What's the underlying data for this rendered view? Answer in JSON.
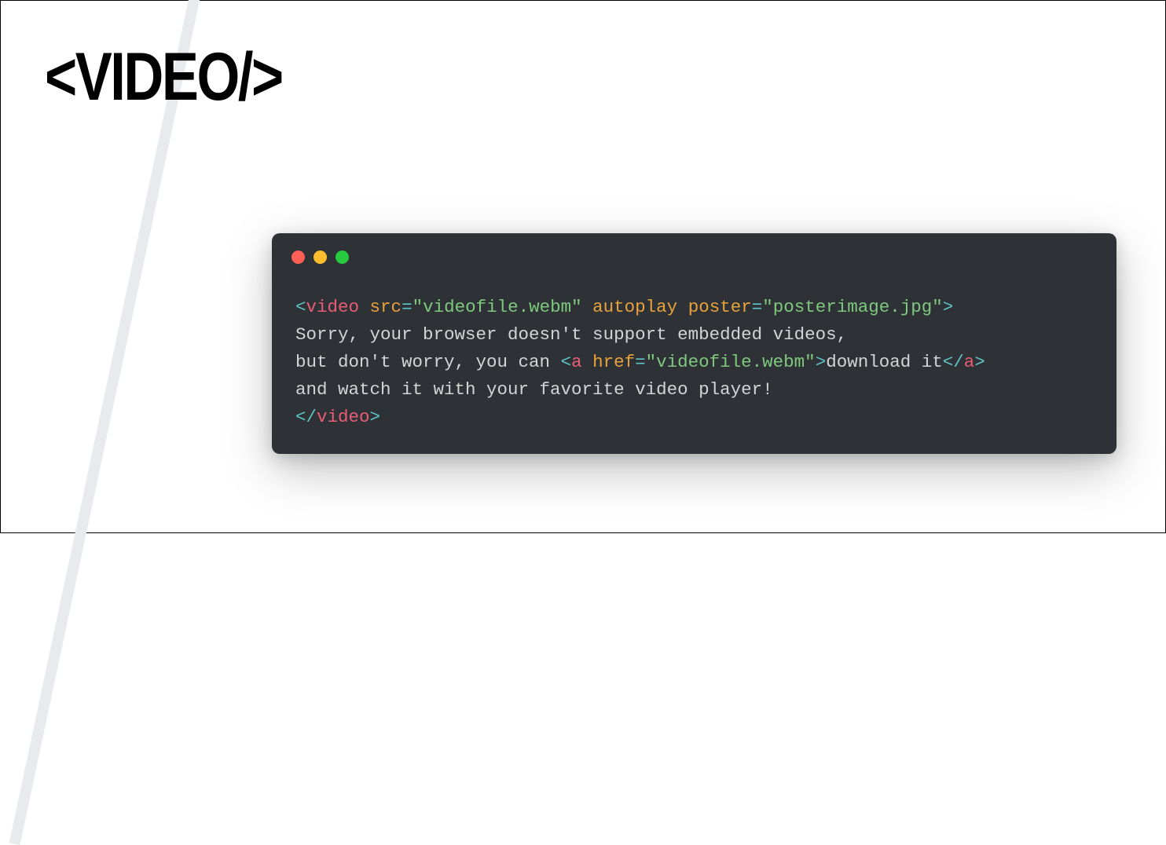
{
  "title": "<VIDEO/>",
  "code": {
    "line1": {
      "open": "<",
      "tag": "video",
      "space1": " ",
      "attr1": "src",
      "eq1": "=",
      "str1": "\"videofile.webm\"",
      "space2": " ",
      "attr2": "autoplay",
      "space3": " ",
      "attr3": "poster",
      "eq2": "=",
      "str2": "\"posterimage.jpg\"",
      "close": ">"
    },
    "line2": "Sorry, your browser doesn't support embedded videos,",
    "line3": {
      "text1": "but don't worry, you can ",
      "open": "<",
      "tag": "a",
      "space": " ",
      "attr": "href",
      "eq": "=",
      "str": "\"videofile.webm\"",
      "close": ">",
      "text2": "download it",
      "copen": "</",
      "ctag": "a",
      "cclose": ">"
    },
    "line4": "and watch it with your favorite video player!",
    "line5": {
      "open": "</",
      "tag": "video",
      "close": ">"
    }
  }
}
